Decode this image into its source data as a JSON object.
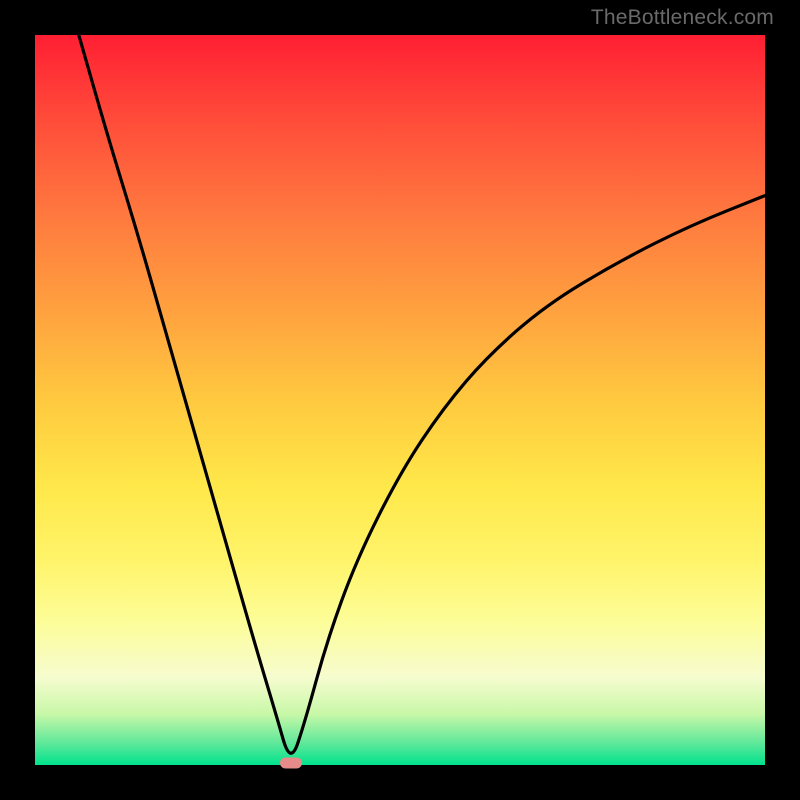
{
  "watermark": {
    "text": "TheBottleneck.com"
  },
  "chart_data": {
    "type": "line",
    "title": "",
    "xlabel": "",
    "ylabel": "",
    "xlim": [
      0,
      100
    ],
    "ylim": [
      0,
      100
    ],
    "grid": false,
    "legend": false,
    "vertex": {
      "x": 35,
      "y": 0
    },
    "series": [
      {
        "name": "curve",
        "x": [
          6,
          10,
          14,
          18,
          22,
          26,
          30,
          33,
          35,
          37,
          40,
          44,
          50,
          56,
          62,
          70,
          80,
          90,
          100
        ],
        "y": [
          100,
          86,
          73,
          59,
          45,
          31,
          17,
          7,
          0,
          6,
          17,
          28,
          40,
          49,
          56,
          63,
          69,
          74,
          78
        ]
      }
    ],
    "background_gradient": {
      "top": "#ff1f33",
      "bottom": "#00e28c"
    }
  }
}
